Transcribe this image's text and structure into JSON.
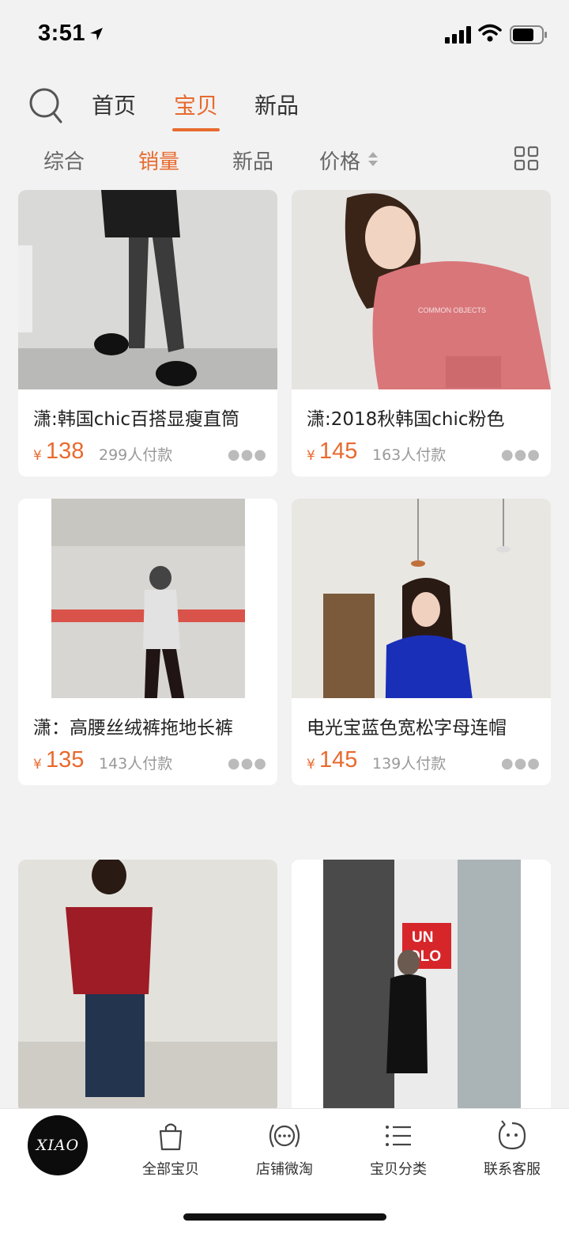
{
  "status_bar": {
    "time": "3:51"
  },
  "top_nav": {
    "tabs": [
      {
        "label": "首页"
      },
      {
        "label": "宝贝"
      },
      {
        "label": "新品"
      }
    ],
    "active_tab": "宝贝"
  },
  "sort_bar": {
    "items": [
      {
        "label": "综合"
      },
      {
        "label": "销量"
      },
      {
        "label": "新品"
      },
      {
        "label": "价格"
      }
    ],
    "active": "销量"
  },
  "products": [
    {
      "title": "潇:韩国chic百搭显瘦直筒",
      "currency": "¥",
      "price": "138",
      "sales": "299人付款"
    },
    {
      "title": "潇:2018秋韩国chic粉色",
      "currency": "¥",
      "price": "145",
      "sales": "163人付款"
    },
    {
      "title": "潇：高腰丝绒裤拖地长裤",
      "currency": "¥",
      "price": "135",
      "sales": "143人付款"
    },
    {
      "title": "电光宝蓝色宽松字母连帽",
      "currency": "¥",
      "price": "145",
      "sales": "139人付款"
    },
    {
      "title": "",
      "currency": "",
      "price": "",
      "sales": ""
    },
    {
      "title": "",
      "currency": "",
      "price": "",
      "sales": ""
    }
  ],
  "photo_text": {
    "hoodie_print": "COMMON OBJECTS",
    "store_sign_line1": "UN",
    "store_sign_line2": "QLO"
  },
  "bottom_bar": {
    "logo_text": "XIAO",
    "tabs": [
      {
        "label": "全部宝贝",
        "icon": "shopping-bag-icon"
      },
      {
        "label": "店铺微淘",
        "icon": "broadcast-icon"
      },
      {
        "label": "宝贝分类",
        "icon": "list-icon"
      },
      {
        "label": "联系客服",
        "icon": "chat-face-icon"
      }
    ]
  },
  "colors": {
    "accent": "#e86a2e",
    "background": "#f2f2f2",
    "muted": "#999999"
  }
}
